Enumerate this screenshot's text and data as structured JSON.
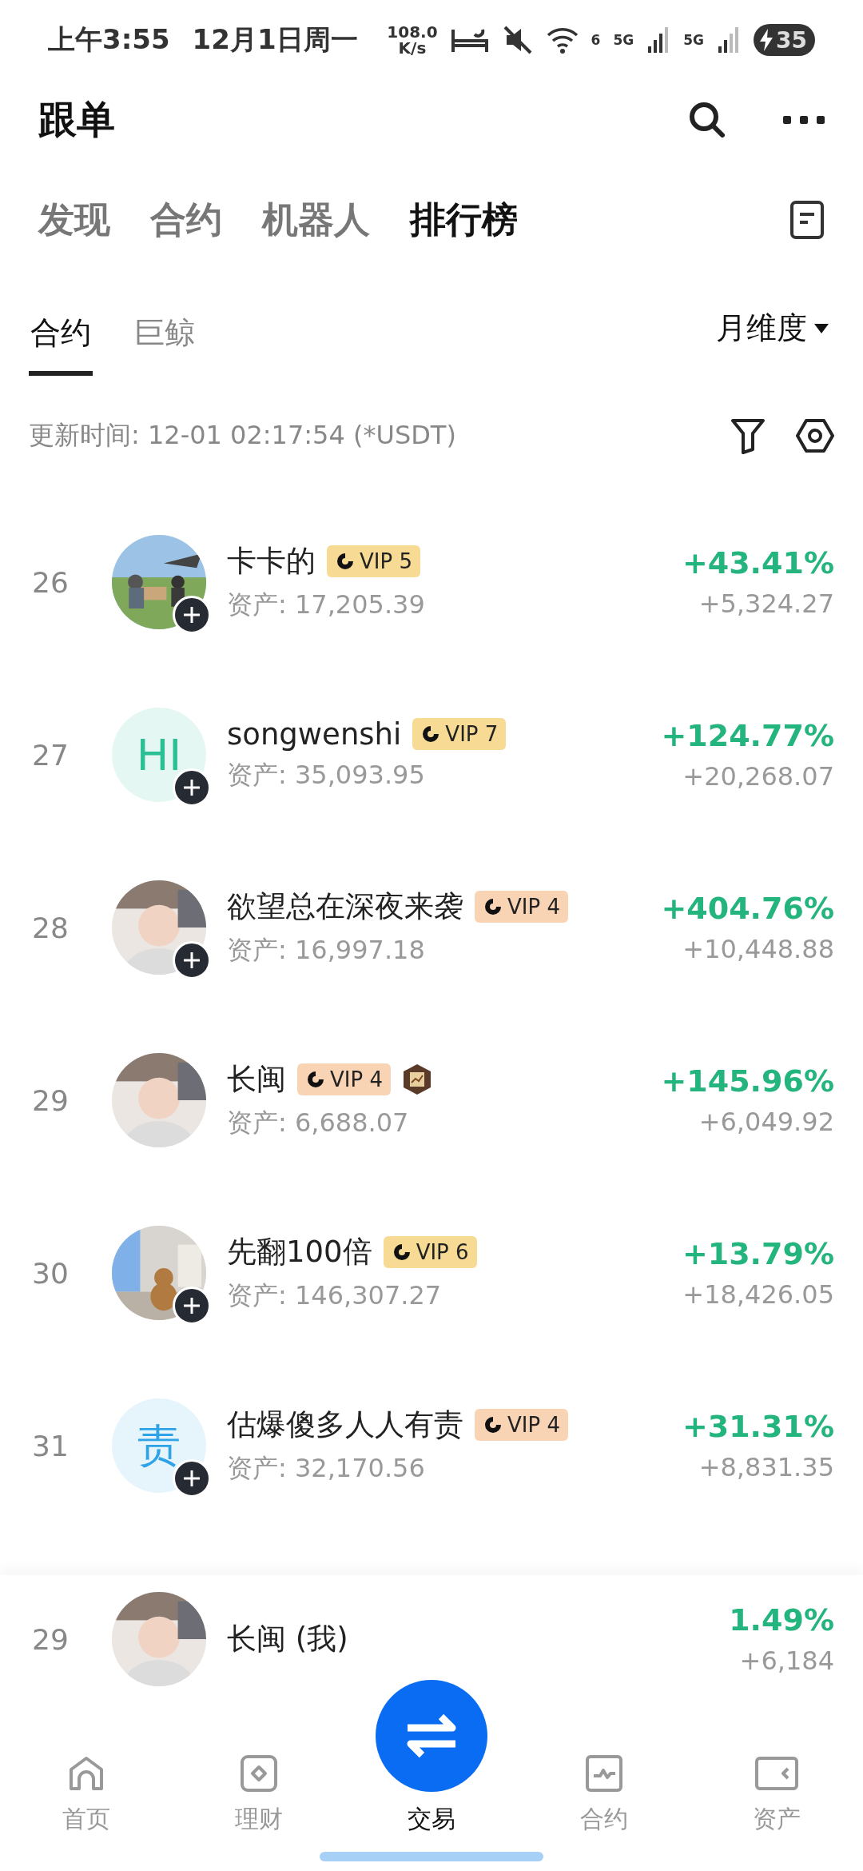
{
  "status_bar": {
    "time": "上午3:55",
    "date": "12月1日周一",
    "speed": "108.0",
    "speed_unit": "K/s",
    "wifi_label": "6",
    "sim_labels": [
      "5G",
      "5G"
    ],
    "battery": "35",
    "charging": true
  },
  "header": {
    "title": "跟单"
  },
  "tabs": [
    {
      "label": "发现",
      "selected": false
    },
    {
      "label": "合约",
      "selected": false
    },
    {
      "label": "机器人",
      "selected": false
    },
    {
      "label": "排行榜",
      "selected": true
    }
  ],
  "sub_tabs": [
    {
      "label": "合约",
      "selected": true
    },
    {
      "label": "巨鲸",
      "selected": false
    }
  ],
  "period_dropdown": "月维度",
  "update_time": "更新时间: 12-01 02:17:54 (*USDT)",
  "rows": [
    {
      "rank": "26",
      "name": "卡卡的",
      "follow_button": true,
      "vip": {
        "label": "VIP 5",
        "color": "#f7da93"
      },
      "medal": false,
      "assets": "资产: 17,205.39",
      "return": "+43.41%",
      "pnl": "+5,324.27"
    },
    {
      "rank": "27",
      "name": "songwenshi",
      "avatar": {
        "kind": "letter",
        "text": "HI",
        "color": "#2bbf96"
      },
      "follow_button": true,
      "vip": {
        "label": "VIP 7",
        "color": "#f7da93"
      },
      "medal": false,
      "assets": "资产: 35,093.95",
      "return": "+124.77%",
      "pnl": "+20,268.07"
    },
    {
      "rank": "28",
      "name": "欲望总在深夜来袭",
      "follow_button": true,
      "vip": {
        "label": "VIP 4",
        "color": "#f9d4b4"
      },
      "medal": false,
      "assets": "资产: 16,997.18",
      "return": "+404.76%",
      "pnl": "+10,448.88"
    },
    {
      "rank": "29",
      "name": "长闽",
      "follow_button": false,
      "vip": {
        "label": "VIP 4",
        "color": "#f9d4b4"
      },
      "medal": true,
      "assets": "资产: 6,688.07",
      "return": "+145.96%",
      "pnl": "+6,049.92"
    },
    {
      "rank": "30",
      "name": "先翻100倍",
      "follow_button": true,
      "vip": {
        "label": "VIP 6",
        "color": "#f7da93"
      },
      "medal": false,
      "assets": "资产: 146,307.27",
      "return": "+13.79%",
      "pnl": "+18,426.05"
    },
    {
      "rank": "31",
      "name": "估爆傻多人人有责",
      "avatar": {
        "kind": "letter",
        "text": "责",
        "color": "#2fa3e8"
      },
      "follow_button": true,
      "vip": {
        "label": "VIP 4",
        "color": "#f9d4b4"
      },
      "medal": false,
      "assets": "资产: 32,170.56",
      "return": "+31.31%",
      "pnl": "+8,831.35"
    }
  ],
  "my_rank": {
    "rank": "29",
    "name": "长闽 (我)",
    "return": "1.49%",
    "pnl": "+6,184"
  },
  "bottom_nav": [
    {
      "label": "首页",
      "kind": "home",
      "selected": false
    },
    {
      "label": "理财",
      "kind": "finance",
      "selected": false
    },
    {
      "label": "交易",
      "kind": "trade",
      "selected": true
    },
    {
      "label": "合约",
      "kind": "contract",
      "selected": false
    },
    {
      "label": "资产",
      "kind": "assets",
      "selected": false
    }
  ]
}
